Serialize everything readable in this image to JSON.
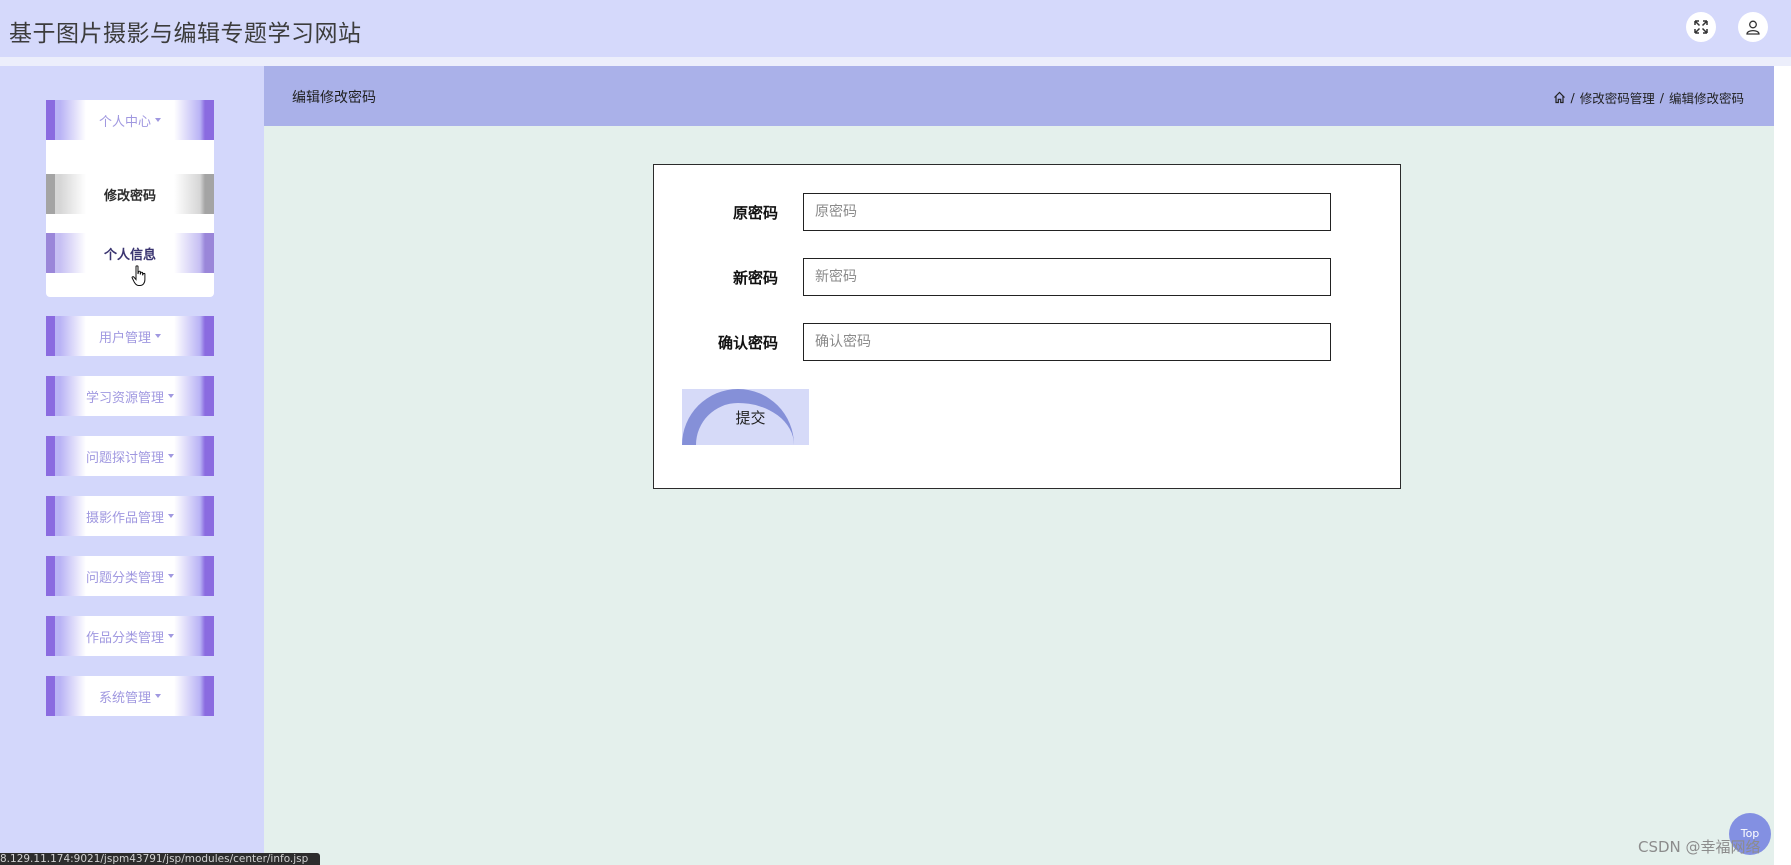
{
  "header": {
    "app_title": "基于图片摄影与编辑专题学习网站"
  },
  "sidebar": {
    "groups": [
      {
        "label": "个人中心"
      },
      {
        "label": "用户管理"
      },
      {
        "label": "学习资源管理"
      },
      {
        "label": "问题探讨管理"
      },
      {
        "label": "摄影作品管理"
      },
      {
        "label": "问题分类管理"
      },
      {
        "label": "作品分类管理"
      },
      {
        "label": "系统管理"
      }
    ],
    "sub_items": [
      {
        "label": "修改密码"
      },
      {
        "label": "个人信息"
      }
    ]
  },
  "page": {
    "title": "编辑修改密码",
    "breadcrumb": {
      "sep": "/",
      "level1": "修改密码管理",
      "level2": "编辑修改密码"
    }
  },
  "form": {
    "fields": [
      {
        "label": "原密码",
        "placeholder": "原密码",
        "value": ""
      },
      {
        "label": "新密码",
        "placeholder": "新密码",
        "value": ""
      },
      {
        "label": "确认密码",
        "placeholder": "确认密码",
        "value": ""
      }
    ],
    "submit_label": "提交"
  },
  "footer": {
    "top_label": "Top",
    "watermark": "CSDN @幸福网络",
    "status_url": "8.129.11.174:9021/jspm43791/jsp/modules/center/info.jsp"
  }
}
